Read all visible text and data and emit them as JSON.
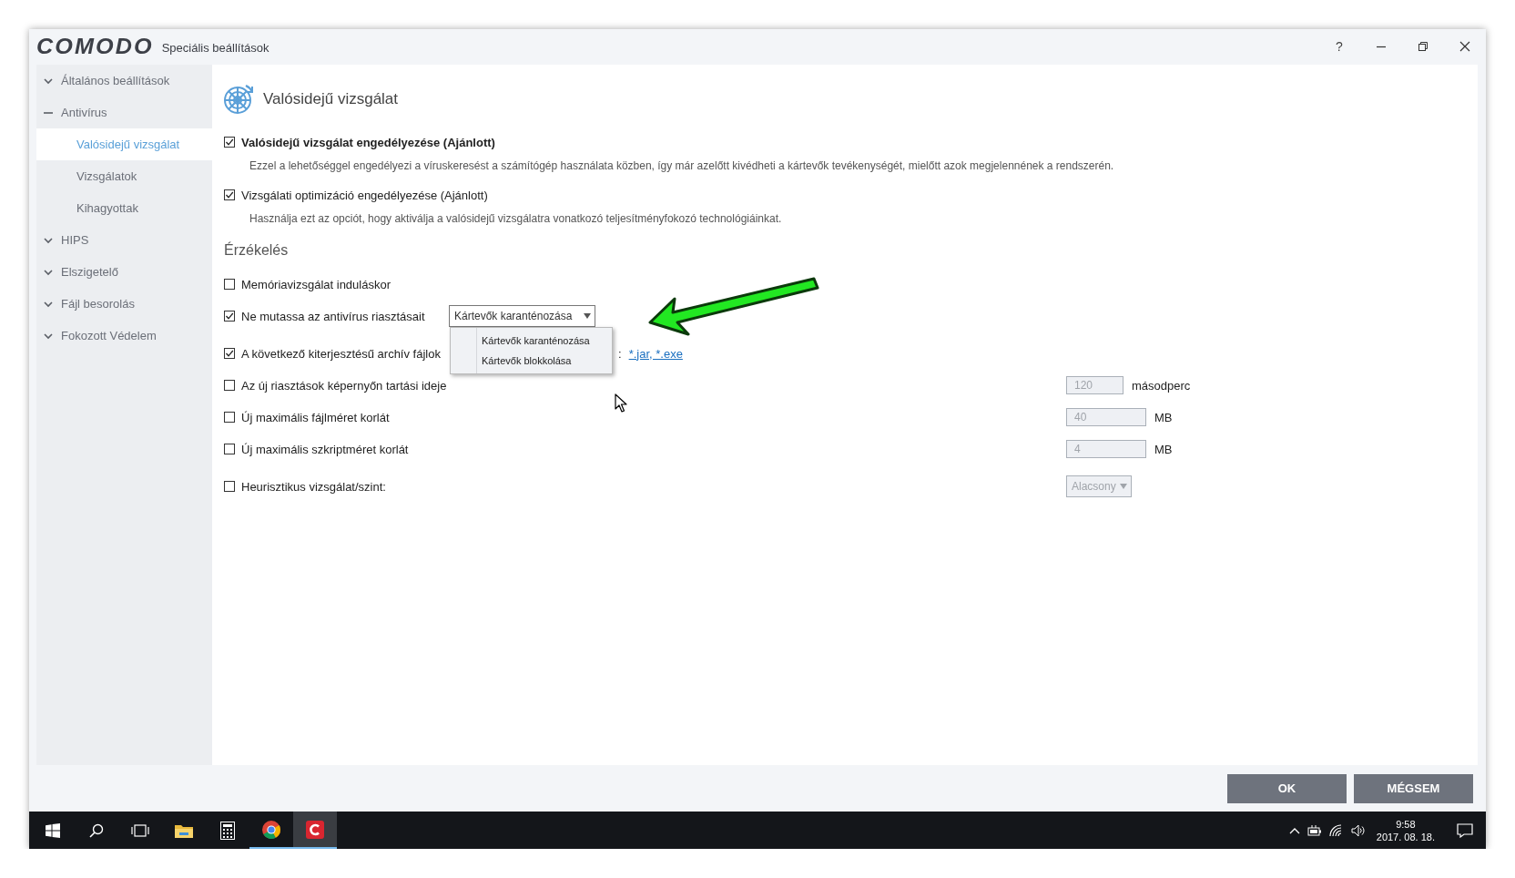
{
  "window": {
    "logo": "COMODO",
    "title": "Speciális beállítások",
    "help": "?"
  },
  "sidebar": {
    "items": [
      {
        "label": "Általános beállítások",
        "expanded": false,
        "selected": false
      },
      {
        "label": "Antivírus",
        "expanded": true,
        "selected": false,
        "children": [
          {
            "label": "Valósidejű vizsgálat",
            "selected": true
          },
          {
            "label": "Vizsgálatok",
            "selected": false
          },
          {
            "label": "Kihagyottak",
            "selected": false
          }
        ]
      },
      {
        "label": "HIPS",
        "expanded": false,
        "selected": false
      },
      {
        "label": "Elszigetelő",
        "expanded": false,
        "selected": false
      },
      {
        "label": "Fájl besorolás",
        "expanded": false,
        "selected": false
      },
      {
        "label": "Fokozott Védelem",
        "expanded": false,
        "selected": false
      }
    ]
  },
  "page": {
    "heading": "Valósidejű vizsgálat",
    "options": [
      {
        "kind": "primary",
        "label": "Valósidejű vizsgálat engedélyezése (Ajánlott)",
        "checked": true,
        "description": "Ezzel a lehetőséggel engedélyezi a víruskeresést a számítógép használata közben, így már azelőtt kivédheti a kártevők tevékenységét, mielőtt azok megjelennének a rendszerén."
      },
      {
        "kind": "secondary",
        "label": "Vizsgálati optimizáció engedélyezése (Ajánlott)",
        "checked": true,
        "description": "Használja ezt az opciót, hogy aktiválja a valósidejű vizsgálatra vonatkozó teljesítményfokozó technológiáinkat."
      }
    ],
    "section_title": "Érzékelés",
    "settings": [
      {
        "kind": "plain",
        "label": "Memóriavizsgálat induláskor",
        "checked": false
      },
      {
        "kind": "select",
        "label": "Ne mutassa az antivírus riasztásait",
        "checked": true,
        "value": "Kártevők karanténozása",
        "expanded": true,
        "options": [
          "Kártevők karanténozása",
          "Kártevők blokkolása"
        ]
      },
      {
        "kind": "link",
        "label": "A következő kiterjesztésű archív fájlok",
        "checked": true,
        "separator": ":",
        "link": "*.jar, *.exe"
      },
      {
        "kind": "number",
        "label": "Az új riasztások képernyőn tartási ideje",
        "checked": false,
        "value": "120",
        "unit": "másodperc",
        "disabled": true
      },
      {
        "kind": "number",
        "label": "Új maximális fájlméret korlát",
        "checked": false,
        "value": "40",
        "unit": "MB",
        "disabled": true
      },
      {
        "kind": "number",
        "label": "Új maximális szkriptméret korlát",
        "checked": false,
        "value": "4",
        "unit": "MB",
        "disabled": true
      },
      {
        "kind": "combo",
        "label": "Heurisztikus vizsgálat/szint:",
        "checked": false,
        "value": "Alacsony",
        "disabled": true
      }
    ]
  },
  "footer": {
    "buttons": [
      "OK",
      "MÉGSEM"
    ]
  },
  "taskbar": {
    "apps": [
      {
        "running": false,
        "selected": false
      },
      {
        "running": false,
        "selected": false
      },
      {
        "running": true,
        "selected": false
      },
      {
        "running": true,
        "selected": true
      }
    ],
    "time": "9:58",
    "date": "2017. 08. 18."
  }
}
